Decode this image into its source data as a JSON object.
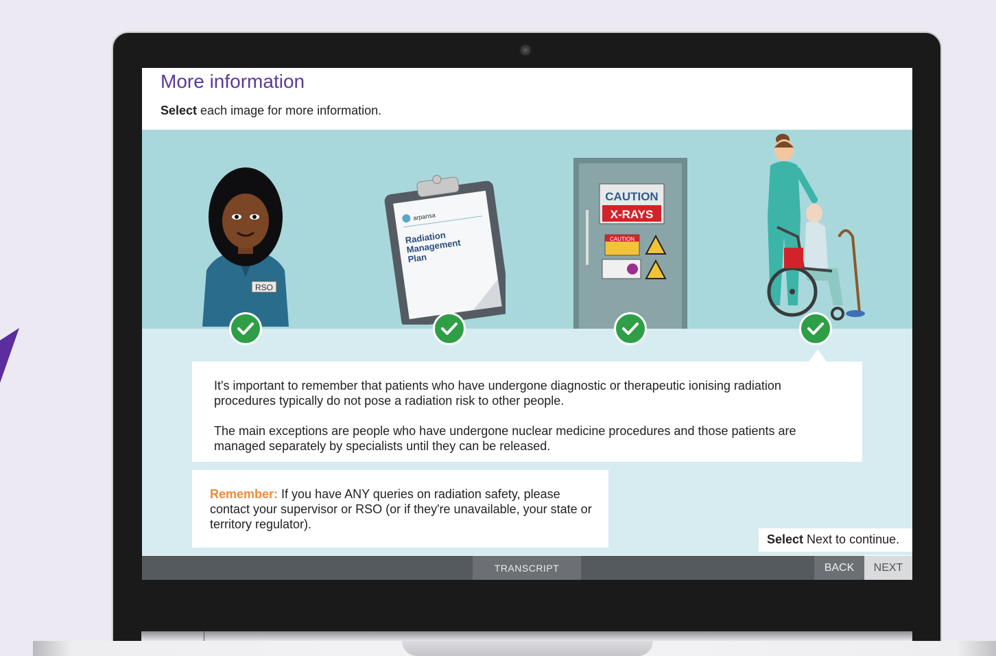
{
  "page": {
    "title": "More information",
    "instruction_bold": "Select",
    "instruction_rest": " each image for more information."
  },
  "scene": {
    "items": [
      {
        "name": "Radiation safety officer",
        "badge": "RSO",
        "completed": true,
        "icon": "check-icon"
      },
      {
        "name": "Radiation management plan",
        "brand": "arpansa",
        "doc_title_line1": "Radiation",
        "doc_title_line2": "Management",
        "doc_title_line3": "Plan",
        "completed": true,
        "icon": "check-icon"
      },
      {
        "name": "X-ray room door",
        "sign_line1": "CAUTION",
        "sign_line2": "X-RAYS",
        "sticker_caution": "CAUTION",
        "completed": true,
        "icon": "check-icon"
      },
      {
        "name": "Nurse with patient in wheelchair",
        "completed": true,
        "icon": "check-icon"
      }
    ]
  },
  "info": {
    "paragraph1": "It's important to remember that patients who have undergone diagnostic or therapeutic ionising radiation procedures typically do not pose a radiation risk to other people.",
    "paragraph2": "The main exceptions are people who have undergone nuclear medicine procedures and those patients are managed separately by specialists until they can be released."
  },
  "remember": {
    "label": "Remember:",
    "text": " If you have ANY queries on radiation safety, please contact your supervisor or RSO (or if they're unavailable, your state or territory regulator)."
  },
  "continue": {
    "bold": "Select",
    "rest": " Next to continue."
  },
  "footer": {
    "transcript_label": "TRANSCRIPT",
    "back_label": "BACK",
    "next_label": "NEXT"
  },
  "colors": {
    "title": "#5b3a98",
    "scene_bg": "#a8d8dc",
    "content_bg": "#d6ecf0",
    "check": "#2e9e47",
    "remember": "#f08b3a",
    "footer": "#555a5e"
  }
}
